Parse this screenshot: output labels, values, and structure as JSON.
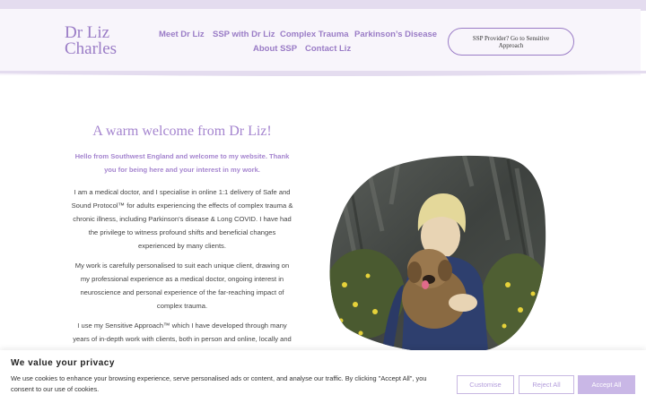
{
  "site": {
    "logo_line1": "Dr Liz",
    "logo_line2": "Charles"
  },
  "nav": {
    "items": [
      {
        "label": "Meet Dr Liz"
      },
      {
        "label": "SSP with Dr Liz"
      },
      {
        "label": "Complex Trauma"
      },
      {
        "label": "Parkinson’s Disease"
      },
      {
        "label": "About SSP"
      },
      {
        "label": "Contact Liz"
      }
    ],
    "cta_label": "SSP Provider? Go to Sensitive Approach"
  },
  "main": {
    "title": "A warm welcome from Dr Liz!",
    "intro": "Hello from Southwest England and welcome to my website. Thank you for being here and your interest in my work.",
    "paragraphs": [
      "I am a medical doctor, and I specialise in online 1:1 delivery of Safe and Sound Protocol™ for adults experiencing the effects of complex trauma & chronic illness, including Parkinson’s disease & Long COVID. I have had the privilege to witness profound shifts and beneficial changes experienced by many clients.",
      "My work is carefully personalised to suit each unique client, drawing on my professional experience as a medical doctor, ongoing interest in neuroscience and personal experience of the far-reaching impact of complex trauma.",
      "I use my Sensitive Approach™ which I have developed through many years of in-depth work with clients, both in person and online, locally and"
    ]
  },
  "consent": {
    "title": "We value your privacy",
    "text": "We use cookies to enhance your browsing experience, serve personalised ads or content, and analyse our traffic. By clicking \"Accept All\", you consent to our use of cookies.",
    "customise_label": "Customise",
    "reject_label": "Reject All",
    "accept_label": "Accept All"
  },
  "colors": {
    "brand": "#9a7cc6",
    "heading": "#a585cf",
    "header_bg": "#f8f5fb",
    "accept_bg": "#c9b7e6"
  }
}
